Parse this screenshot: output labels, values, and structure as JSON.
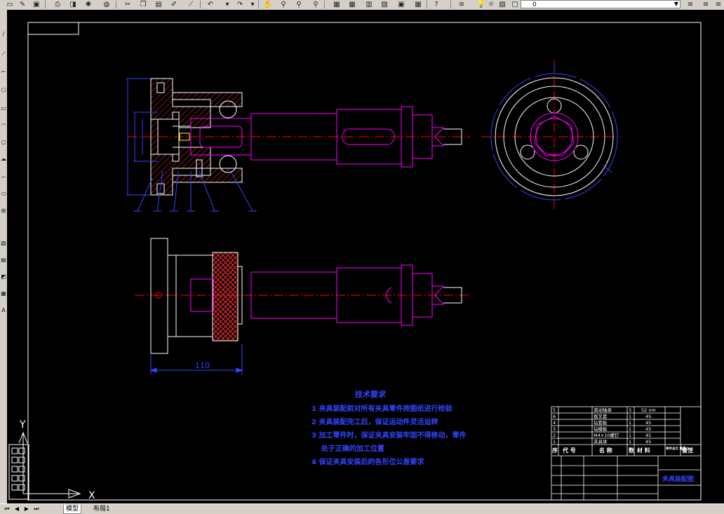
{
  "toolbar": {
    "layer_value": "0",
    "colors": {
      "face": "#d4d0c8",
      "shadow": "#808080"
    }
  },
  "drawing": {
    "dimension_110": "110",
    "label_ucs_y": "Y",
    "label_ucs_x": "X",
    "colors": {
      "magenta": "#ff00ff",
      "red": "#ff0000",
      "white": "#ffffff",
      "blue": "#3344ff",
      "hatch": "#ff3030"
    }
  },
  "tech_requirements": {
    "title": "技术要求",
    "items": [
      "1  夹具装配前对所有夹具零件按图纸进行检验",
      "2  夹具装配完工后，保证运动件灵活运转",
      "3  加工零件时，保证夹具安装牢固不得移动，零件",
      "    处于正确的加工位置",
      "4  保证夹具安装后的各形位公差要求"
    ]
  },
  "title_block": {
    "rows": [
      {
        "num": "5",
        "name": "滚动轴承",
        "qty": "3",
        "material": "52 nm"
      },
      {
        "num": "6",
        "name": "拔叉套",
        "qty": "1",
        "material": "45"
      },
      {
        "num": "4",
        "name": "钻套板",
        "qty": "1",
        "material": "45"
      },
      {
        "num": "3",
        "name": "钻模板",
        "qty": "1",
        "material": "45"
      },
      {
        "num": "2",
        "name": "M4×10螺钉",
        "qty": "1",
        "material": "45"
      },
      {
        "num": "1",
        "name": "夹具体",
        "qty": "1",
        "material": "45"
      }
    ],
    "headers": [
      "序",
      "代  号",
      "名  称",
      "数",
      "材  料",
      "单件总计 重量(kg)",
      "备注"
    ],
    "drawing_name": "夹具装配图"
  },
  "tabs": {
    "model": "模型",
    "layout1": "布局1"
  }
}
